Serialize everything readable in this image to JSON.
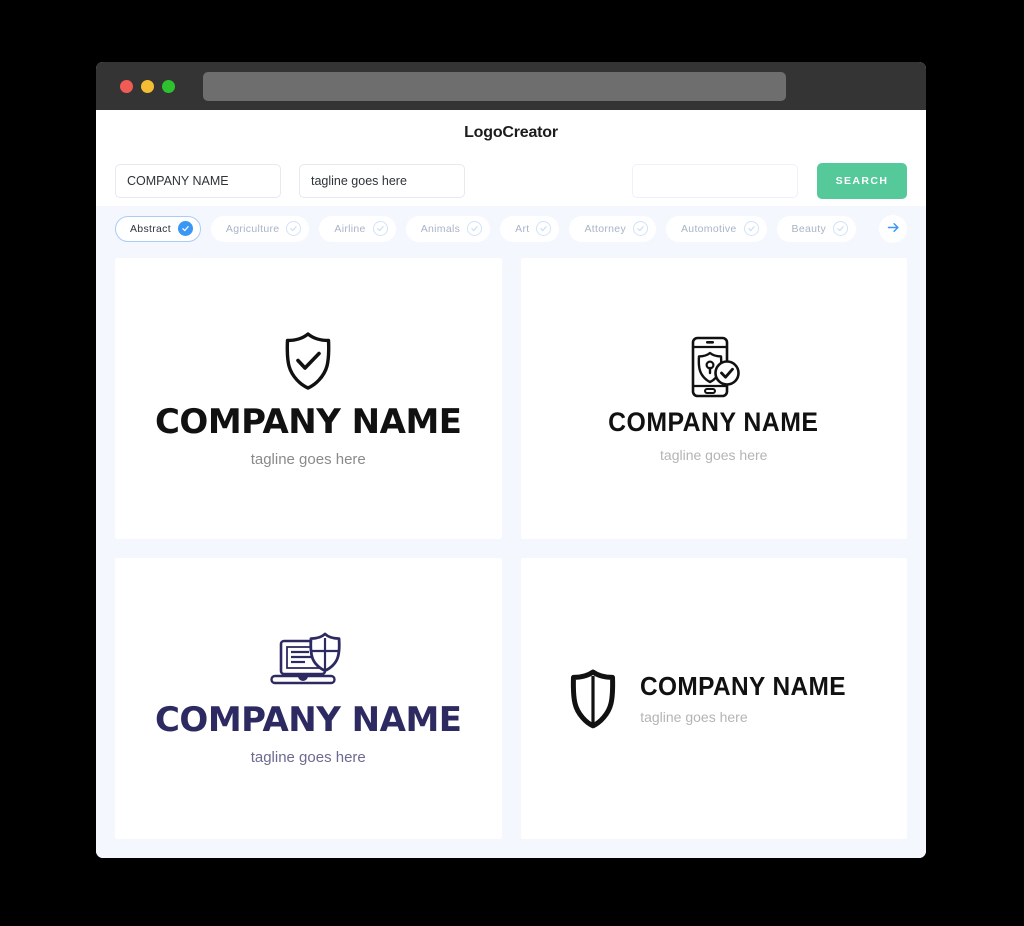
{
  "window": {
    "traffic_lights": [
      "close",
      "minimize",
      "maximize"
    ],
    "url_value": ""
  },
  "header": {
    "title": "LogoCreator"
  },
  "search": {
    "company_value": "COMPANY NAME",
    "company_placeholder": "COMPANY NAME",
    "tagline_value": "tagline goes here",
    "tagline_placeholder": "tagline goes here",
    "keyword_value": "",
    "keyword_placeholder": "",
    "search_label": "SEARCH"
  },
  "categories": {
    "next_icon": "arrow-right-icon",
    "items": [
      {
        "label": "Abstract",
        "selected": true
      },
      {
        "label": "Agriculture",
        "selected": false
      },
      {
        "label": "Airline",
        "selected": false
      },
      {
        "label": "Animals",
        "selected": false
      },
      {
        "label": "Art",
        "selected": false
      },
      {
        "label": "Attorney",
        "selected": false
      },
      {
        "label": "Automotive",
        "selected": false
      },
      {
        "label": "Beauty",
        "selected": false
      }
    ]
  },
  "results": [
    {
      "icon": "shield-check-icon",
      "name": "COMPANY NAME",
      "tagline": "tagline goes here",
      "name_color": "#111111",
      "tagline_color": "#8a8a8a"
    },
    {
      "icon": "mobile-shield-lock-check-icon",
      "name": "COMPANY NAME",
      "tagline": "tagline goes here",
      "name_color": "#111111",
      "tagline_color": "#b4b4b4"
    },
    {
      "icon": "laptop-shield-cross-icon",
      "name": "COMPANY NAME",
      "tagline": "tagline goes here",
      "name_color": "#2d2a62",
      "tagline_color": "#6b6a91"
    },
    {
      "icon": "shield-split-icon",
      "name": "COMPANY NAME",
      "tagline": "tagline goes here",
      "name_color": "#111111",
      "tagline_color": "#b4b4b4"
    }
  ],
  "colors": {
    "accent_green": "#55c999",
    "accent_blue": "#3b97f5",
    "page_bg": "#f4f7fd",
    "titlebar": "#343434"
  }
}
